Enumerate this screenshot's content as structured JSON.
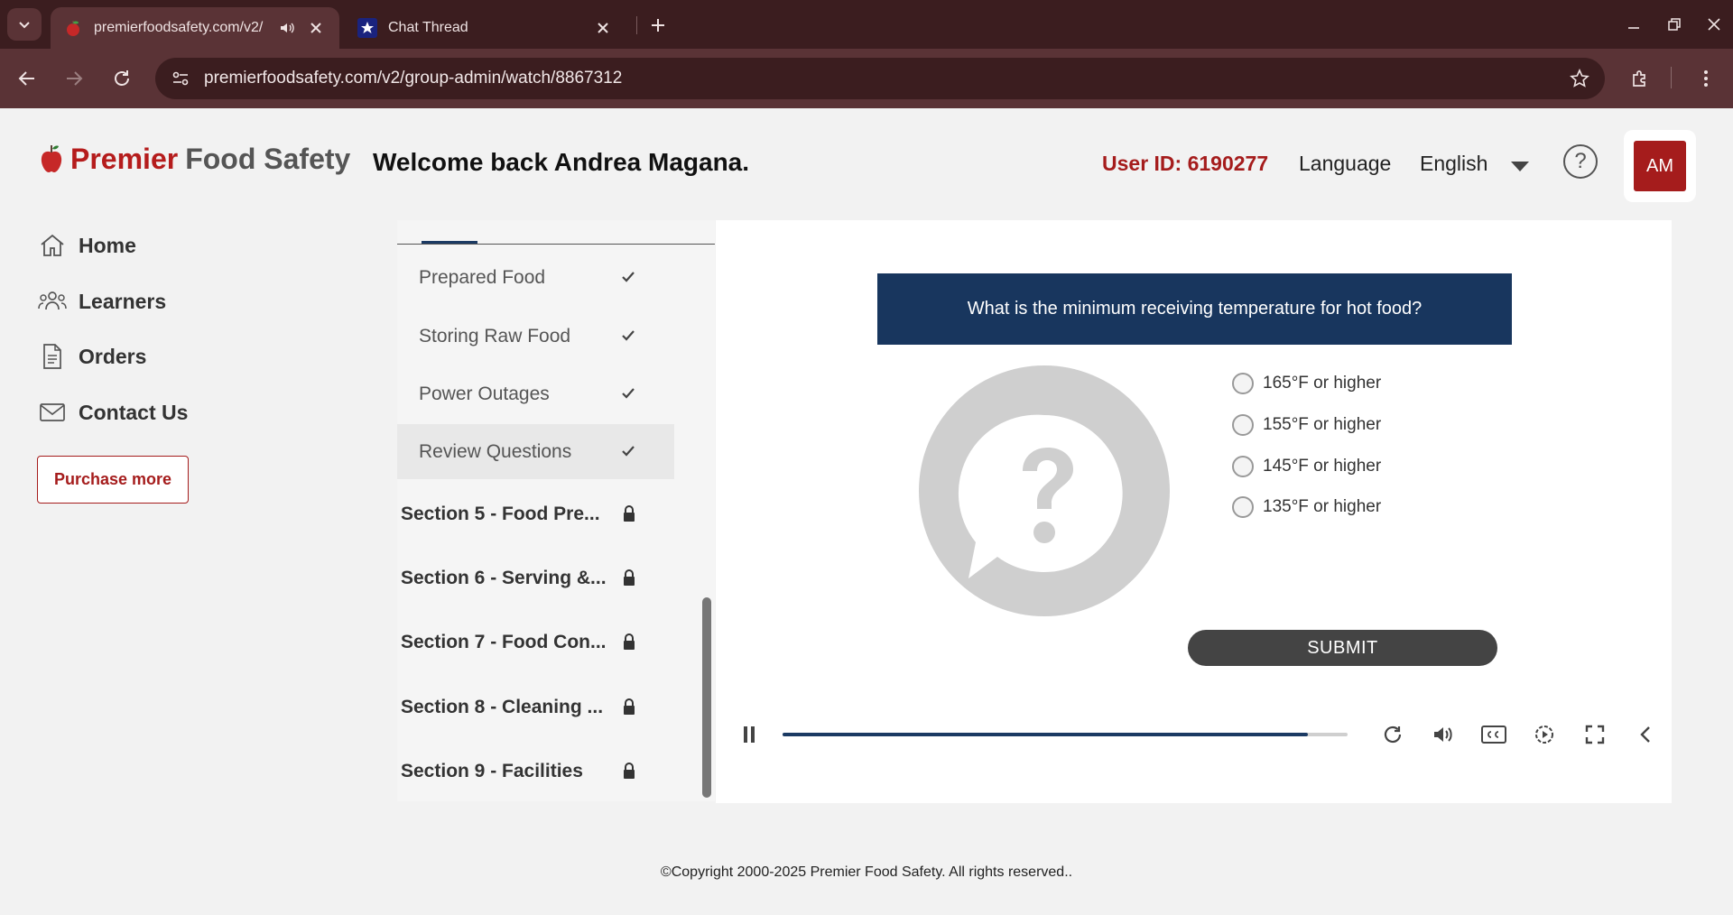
{
  "browser": {
    "tabs": [
      {
        "title": "premierfoodsafety.com/v2/",
        "active": true
      },
      {
        "title": "Chat Thread",
        "active": false
      }
    ],
    "url": "premierfoodsafety.com/v2/group-admin/watch/8867312"
  },
  "header": {
    "brand_part1": "Premier",
    "brand_part2": "Food Safety",
    "welcome": "Welcome back Andrea Magana.",
    "user_id": "User ID: 6190277",
    "language_label": "Language",
    "language_value": "English",
    "help": "?",
    "avatar_initials": "AM"
  },
  "sidebar": {
    "items": [
      {
        "label": "Home",
        "icon": "home-icon"
      },
      {
        "label": "Learners",
        "icon": "users-icon"
      },
      {
        "label": "Orders",
        "icon": "document-icon"
      },
      {
        "label": "Contact Us",
        "icon": "mail-icon"
      }
    ],
    "purchase_label": "Purchase more"
  },
  "outline": {
    "lessons": [
      {
        "label": "Prepared Food",
        "completed": true
      },
      {
        "label": "Storing Raw Food",
        "completed": true
      },
      {
        "label": "Power Outages",
        "completed": true
      },
      {
        "label": "Review Questions",
        "completed": true,
        "current": true
      }
    ],
    "sections": [
      {
        "label": "Section 5 - Food Pre...",
        "locked": true
      },
      {
        "label": "Section 6 - Serving &...",
        "locked": true
      },
      {
        "label": "Section 7 - Food Con...",
        "locked": true
      },
      {
        "label": "Section 8 - Cleaning ...",
        "locked": true
      },
      {
        "label": "Section 9 - Facilities",
        "locked": true
      }
    ]
  },
  "quiz": {
    "question": "What is the minimum receiving temperature for hot food?",
    "options": [
      "165°F or higher",
      "155°F or higher",
      "145°F or higher",
      "135°F or higher"
    ],
    "submit_label": "SUBMIT"
  },
  "player": {
    "progress": 0.93
  },
  "footer": {
    "copyright": "©Copyright 2000-2025 Premier Food Safety. All rights reserved.."
  },
  "colors": {
    "brand_red": "#a51c1c",
    "navy": "#18365e",
    "chrome_dark": "#3b1d1f",
    "chrome_mid": "#5a3336"
  }
}
